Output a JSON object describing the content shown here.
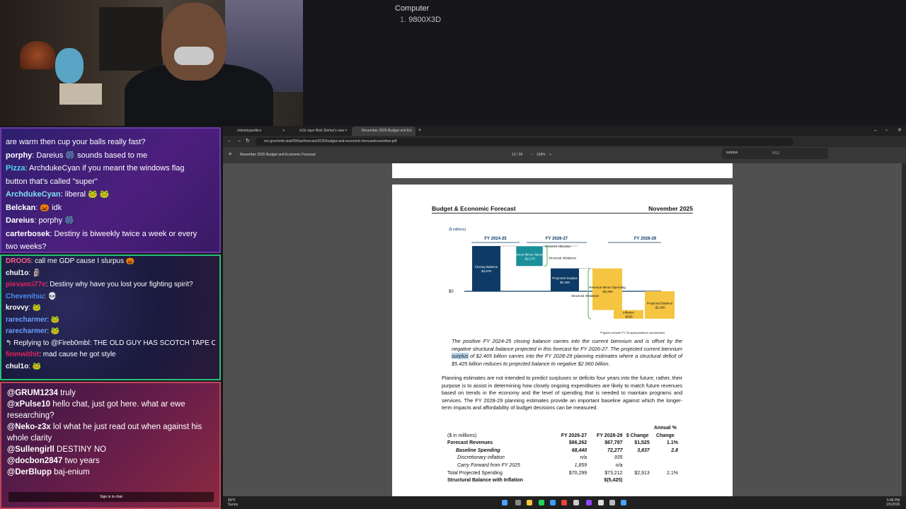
{
  "spec": {
    "title": "Computer",
    "items": [
      {
        "num": "1.",
        "label": "9800X3D"
      }
    ]
  },
  "chat_panel_1": [
    {
      "user": "",
      "text": "are warm then cup your balls really fast?",
      "color": "#ffffff"
    },
    {
      "user": "porphy",
      "text": ": Dareius 🎆 sounds based to me",
      "color": "#ffffff"
    },
    {
      "user": "Pizza",
      "text": ": ArchdukeCyan if you meant the windows flag",
      "color": "#4cd8f0"
    },
    {
      "user": "",
      "text": "button that's called \"super\"",
      "color": "#ffffff"
    },
    {
      "user": "ArchdukeCyan",
      "text": ": liberal 🐸 🐸",
      "color": "#7ee0f0"
    },
    {
      "user": "Belckan",
      "text": ": 🎃 idk",
      "color": "#ffffff"
    },
    {
      "user": "Dareius",
      "text": ": porphy 🎆",
      "color": "#ffffff"
    },
    {
      "user": "carterbosek",
      "text": ": Destiny is biweekly twice a week or every",
      "color": "#ffffff"
    },
    {
      "user": "",
      "text": "two weeks?",
      "color": "#ffffff"
    }
  ],
  "chat_panel_2": [
    {
      "user": "DROO5",
      "text": ": call me GDP cause I slurpus 🎃",
      "color": "#ff5e8c"
    },
    {
      "user": "chul1o",
      "text": ": 🗿",
      "color": "#ffffff"
    },
    {
      "user": "pievanci77e",
      "text": ": Destiny why have you lost your fighting spirit?",
      "color": "#e0245e"
    },
    {
      "user": "Chevenitsu",
      "text": ": 💀",
      "color": "#4c8ff0"
    },
    {
      "user": "krovvy",
      "text": ": 🐸",
      "color": "#ffffff"
    },
    {
      "user": "rarecharmer",
      "text": ": 🐸",
      "color": "#6aa0ff"
    },
    {
      "user": "rarecharmer",
      "text": ": 🐸",
      "color": "#6aa0ff"
    },
    {
      "user": "",
      "text": "↰ Replying to @Fireb0mbl: THE OLD GUY HAS SCOTCH TAPE ON HIS FUCKING JA...",
      "color": "#dddddd"
    },
    {
      "user": "finmwithit",
      "text": ": mad cause he got style",
      "color": "#e0245e"
    },
    {
      "user": "chul1o",
      "text": ": 🐸",
      "color": "#ffffff"
    }
  ],
  "chat_panel_3": [
    {
      "user": "@GRUM1234",
      "text": " truly"
    },
    {
      "user": "@xPulse10",
      "text": " hello chat, just got here. what ar ewe researching?"
    },
    {
      "user": "@Neko-z3x",
      "text": " lol what he just read out when against his whole clarity"
    },
    {
      "user": "@Sullengirll",
      "text": " DESTINY NO"
    },
    {
      "user": "@docbon2847",
      "text": " two years"
    },
    {
      "user": "@DerBlupp",
      "text": " baj-enium"
    }
  ],
  "chat_signin": "Sign in to chat",
  "browser": {
    "tabs": [
      {
        "label": "r/destinypolitics",
        "active": false
      },
      {
        "label": "d.Gr says Nick Shirley's new",
        "active": false
      },
      {
        "label": "November 2025 Budget and Ec",
        "active": true
      }
    ],
    "url": "mn.gov/mmb-stat/000/az/forecast/2025/budget-and-economic-forecast/november.pdf",
    "pdf_title": "November 2025 Budget and Economic Forecast",
    "page_num": "13",
    "page_total": "/ 99",
    "zoom": "158%",
    "find_query": "surplus",
    "find_count": "6/13"
  },
  "page": {
    "header_left": "Budget & Economic Forecast",
    "header_right": "November 2025",
    "para1_before": "The positive FY 2024-25 closing balance carries into the current biennium and is offset by the negative structural balance projected in this forecast for FY 2026-27.  The projected current biennium ",
    "para1_highlight": "surplus",
    "para1_after": " of $2.465 billion carries into the FY 2028-29 planning estimates where a structural deficit of $5.425 billion reduces to projected balance to negative $2.960 billion.",
    "para2": "Planning estimates are not intended to predict surpluses or deficits four years into the future; rather, their purpose is to assist in determining how closely ongoing expenditures are likely to match future revenues based on trends in the economy and the level of spending that is needed to maintain programs and services. The FY 2028-29 planning estimates provide an important baseline against which the longer-term impacts and affordability of budget decisions can be measured.",
    "table": {
      "headers": [
        "($ in millions)",
        "FY 2026-27",
        "FY 2028-29",
        "$ Change",
        "Annual % Change"
      ],
      "rows": [
        {
          "label": "Forecast Revenues",
          "v1": "$66,262",
          "v2": "$67,787",
          "v3": "$1,525",
          "v4": "1.1%",
          "style": "bold",
          "indent": 0
        },
        {
          "label": "Baseline Spending",
          "v1": "68,440",
          "v2": "72,277",
          "v3": "3,837",
          "v4": "2.8",
          "style": "bolditalic",
          "indent": 1
        },
        {
          "label": "Discretionary inflation",
          "v1": "n/a",
          "v2": "935",
          "v3": "",
          "v4": "",
          "style": "italic",
          "indent": 2
        },
        {
          "label": "Carry Forward from FY 2025",
          "v1": "1,859",
          "v2": "n/a",
          "v3": "",
          "v4": "",
          "style": "italic",
          "indent": 2
        },
        {
          "label": "Total Projected Spending",
          "v1": "$70,299",
          "v2": "$73,212",
          "v3": "$2,913",
          "v4": "2.1%",
          "style": "normal",
          "indent": 0
        },
        {
          "label": "Structural Balance with Inflation",
          "v1": "",
          "v2": "$(5,425)",
          "v3": "",
          "v4": "",
          "style": "bold",
          "indent": 0
        }
      ]
    }
  },
  "chart_data": {
    "type": "bar",
    "units": "($ millions)",
    "groups": [
      "FY 2024-25",
      "FY 2026-27",
      "FY 2028-29"
    ],
    "bars": [
      {
        "label": "Closing Balance",
        "value": "$4,878",
        "amount": 4878,
        "color": "#0d3b66"
      },
      {
        "label": "Revenue Minus Spending",
        "value": "-$2,178",
        "amount": -2178,
        "color": "#1a8f9a"
      },
      {
        "label": "Projected Surplus",
        "value": "$2,465",
        "amount": 2465,
        "color": "#0d3b66"
      },
      {
        "label": "Revenue Minus Spending",
        "value": "-$4,490",
        "amount": -4490,
        "color": "#f5c542"
      },
      {
        "label": "Inflation",
        "value": "-$935",
        "amount": -935,
        "color": "#f5c542"
      },
      {
        "label": "Projected Balance",
        "value": "-$2,960",
        "amount": -2960,
        "color": "#f5c542"
      }
    ],
    "annotations": [
      "Reserve Allocation",
      "Structural Imbalance",
      "Structural Imbalance"
    ],
    "zero_label": "$0",
    "footnote": "*Figures exclude FY 25 appropriations carryforward"
  },
  "taskbar": {
    "weather_temp": "69°F",
    "weather_desc": "Sunny",
    "time": "5:45 PM",
    "date": "1/5/2026"
  }
}
